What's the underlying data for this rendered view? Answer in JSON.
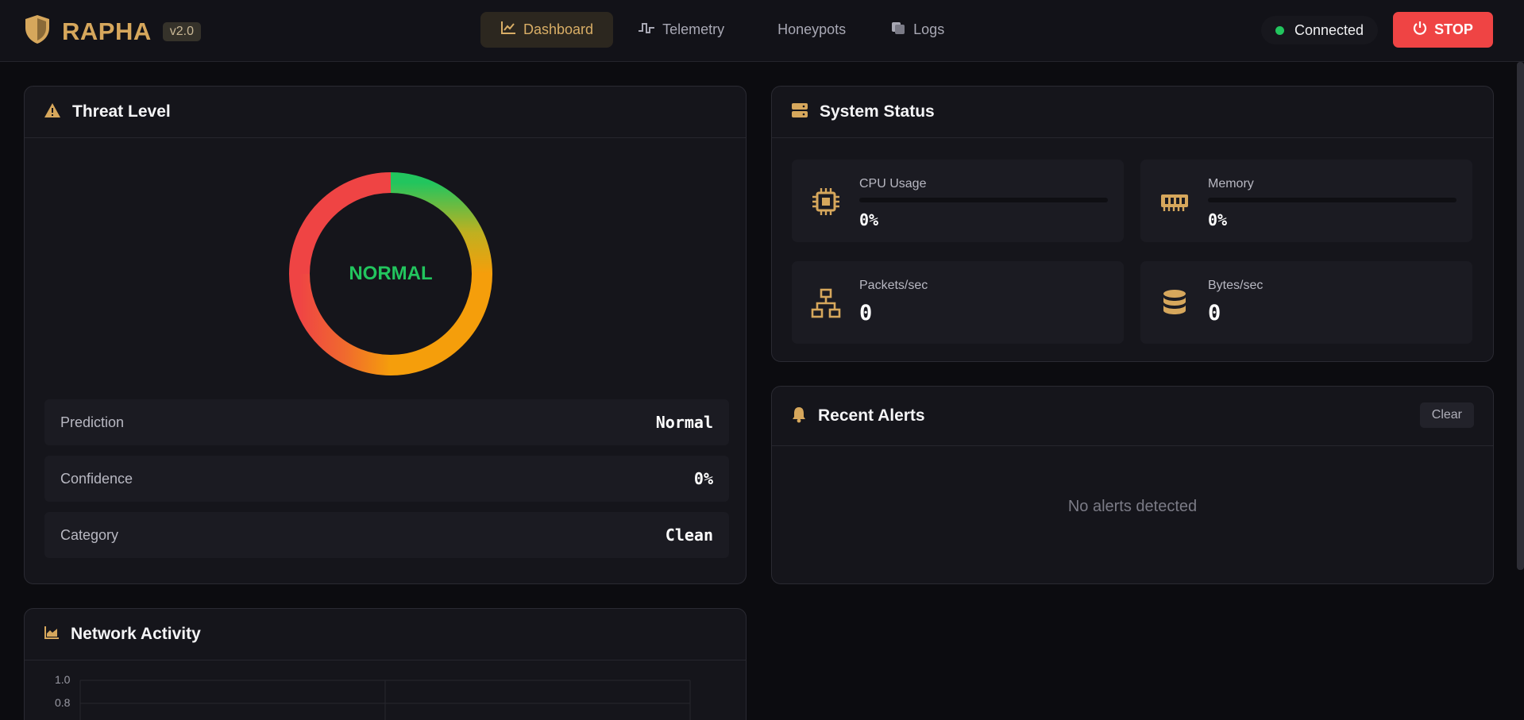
{
  "app": {
    "name": "RAPHA",
    "version": "v2.0"
  },
  "nav": [
    {
      "label": "Dashboard",
      "icon": "chart-line-icon",
      "active": true
    },
    {
      "label": "Telemetry",
      "icon": "pulse-icon",
      "active": false
    },
    {
      "label": "Honeypots",
      "icon": "",
      "active": false
    },
    {
      "label": "Logs",
      "icon": "scroll-icon",
      "active": false
    }
  ],
  "connection": {
    "status": "Connected",
    "color": "#22c55e"
  },
  "stop_button": {
    "label": "STOP",
    "color": "#ef4444"
  },
  "threat": {
    "title": "Threat Level",
    "level": "NORMAL",
    "rows": [
      {
        "label": "Prediction",
        "value": "Normal"
      },
      {
        "label": "Confidence",
        "value": "0%"
      },
      {
        "label": "Category",
        "value": "Clean"
      }
    ]
  },
  "system": {
    "title": "System Status",
    "cpu": {
      "label": "CPU Usage",
      "value": "0%",
      "fraction": 0
    },
    "memory": {
      "label": "Memory",
      "value": "0%",
      "fraction": 0
    },
    "packets": {
      "label": "Packets/sec",
      "value": "0"
    },
    "bytes": {
      "label": "Bytes/sec",
      "value": "0"
    }
  },
  "alerts": {
    "title": "Recent Alerts",
    "clear_label": "Clear",
    "empty_text": "No alerts detected"
  },
  "network": {
    "title": "Network Activity",
    "y_ticks": [
      "1.0",
      "0.8"
    ]
  },
  "colors": {
    "accent": "#d6a75c",
    "danger": "#ef4444",
    "ok": "#22c55e",
    "warn": "#f59e0b"
  }
}
